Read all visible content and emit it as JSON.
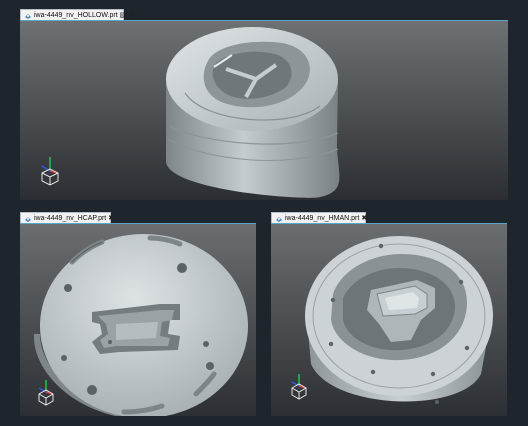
{
  "panes": {
    "top": {
      "tab_label": "iwa-4449_nv_HOLLOW.prt"
    },
    "bottom_left": {
      "tab_label": "iwa-4449_nv_HCAP.prt"
    },
    "bottom_right": {
      "tab_label": "iwa-4449_nv_HMAN.prt"
    }
  },
  "icons": {
    "part_icon": "part-file-icon",
    "copy": "copy-icon",
    "close": "close-icon",
    "triad": "view-triad-cube-icon"
  },
  "colors": {
    "background": "#1f252c",
    "tab_underline": "#5aa6c8",
    "viewport_top": "#6b6e71",
    "viewport_bottom": "#2c2f33",
    "model_gray": "#c9cfd2"
  }
}
